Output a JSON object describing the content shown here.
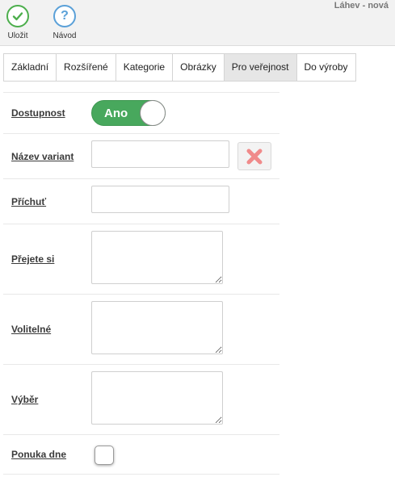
{
  "header": {
    "title": "Láhev - nová",
    "save": {
      "label": "Uložit",
      "icon": "check-circle-icon",
      "color": "#4cae4c"
    },
    "help": {
      "label": "Návod",
      "icon_glyph": "?",
      "icon": "question-circle-icon",
      "color": "#5aa0d8"
    }
  },
  "tabs": [
    {
      "label": "Základní",
      "active": false
    },
    {
      "label": "Rozšířené",
      "active": false
    },
    {
      "label": "Kategorie",
      "active": false
    },
    {
      "label": "Obrázky",
      "active": false
    },
    {
      "label": "Pro veřejnost",
      "active": true
    },
    {
      "label": "Do výroby",
      "active": false
    }
  ],
  "form": {
    "dostupnost": {
      "label": "Dostupnost",
      "toggle_text": "Ano",
      "toggle_on": true,
      "color": "#48a85d"
    },
    "nazev_variant": {
      "label": "Název variant",
      "value": "",
      "remove_icon": "remove-x-icon",
      "remove_color": "#f08a8a"
    },
    "prichut": {
      "label": "Příchuť",
      "value": ""
    },
    "prejete_si": {
      "label": "Přejete si",
      "value": ""
    },
    "volitelne": {
      "label": "Volitelné",
      "value": ""
    },
    "vyber": {
      "label": "Výběr",
      "value": ""
    },
    "ponuka_dne": {
      "label": "Ponuka dne",
      "checked": false
    }
  }
}
